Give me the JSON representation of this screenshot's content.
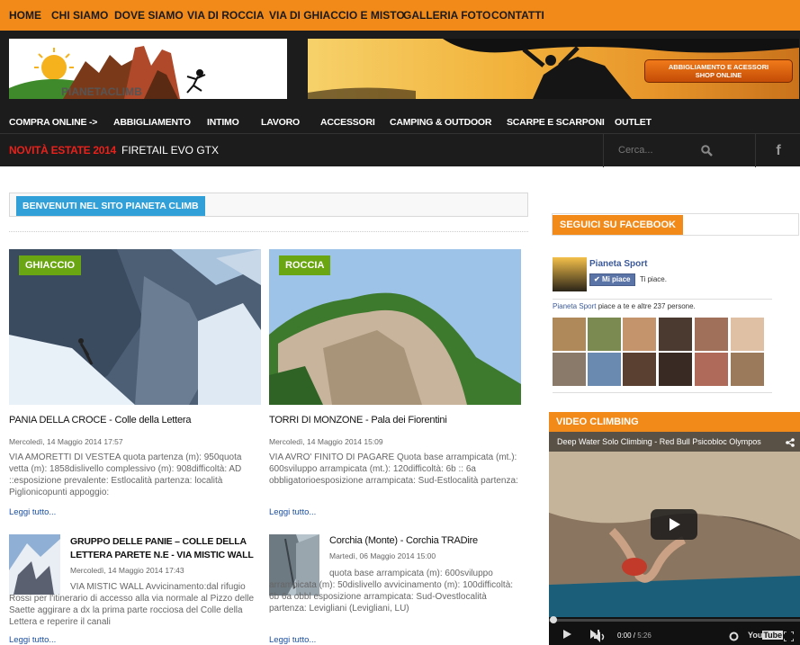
{
  "top_nav": [
    "HOME",
    "CHI SIAMO",
    "DOVE SIAMO",
    "VIA DI ROCCIA",
    "VIA DI GHIACCIO E MISTO",
    "GALLERIA FOTO",
    "CONTATTI"
  ],
  "logo_text": "PIANETACLIMB",
  "banner_button": {
    "line1": "ABBIGLIAMENTO E ACESSORI",
    "line2": "SHOP ONLINE"
  },
  "cat_nav": [
    "COMPRA ONLINE ->",
    "ABBIGLIAMENTO",
    "INTIMO",
    "LAVORO",
    "ACCESSORI",
    "CAMPING & OUTDOOR",
    "SCARPE E SCARPONI",
    "OUTLET"
  ],
  "ticker": {
    "label": "NOVITÀ ESTATE 2014",
    "text": "FIRETAIL EVO GTX"
  },
  "search": {
    "placeholder": "Cerca..."
  },
  "welcome": "BENVENUTI NEL SITO PIANETA CLIMB",
  "featured": [
    {
      "tag": "GHIACCIO",
      "title": "PANIA DELLA CROCE - Colle della Lettera",
      "date": "Mercoledì, 14 Maggio 2014 17:57",
      "body": "VIA AMORETTI DI VESTEA quota partenza (m): 950quota vetta (m): 1858dislivello complessivo (m): 908difficoltà: AD ::esposizione prevalente: Estlocalità partenza: località Piglionicopunti appoggio:",
      "more": "Leggi tutto..."
    },
    {
      "tag": "ROCCIA",
      "title": "TORRI DI MONZONE - Pala dei Fiorentini",
      "date": "Mercoledì, 14 Maggio 2014 15:09",
      "body": "VIA  AVRO' FINITO DI PAGARE   Quota base arrampicata (mt.): 600sviluppo arrampicata (mt.): 120difficoltà: 6b :: 6a obbligatorioesposizione arrampicata: Sud-Estlocalità partenza:",
      "more": "Leggi tutto..."
    }
  ],
  "small": [
    {
      "title": "GRUPPO DELLE PANIE – COLLE DELLA LETTERA PARETE N.E - VIA MISTIC WALL",
      "title1": "GRUPPO DELLE PANIE – COLLE DELLA",
      "title2": "LETTERA PARETE N.E - VIA MISTIC WALL",
      "date": "Mercoledì, 14 Maggio 2014 17:43",
      "body": "VIA MISTIC WALL Avvicinamento:dal rifugio Rossi per l'itinerario di accesso alla via normale al Pizzo delle Saette aggirare a dx la prima parte rocciosa del Colle della Lettera e reperire il canali",
      "more": "Leggi tutto..."
    },
    {
      "title": "Corchia (Monte) - Corchia TRADire",
      "date": "Martedì, 06 Maggio 2014 15:00",
      "body": "quota base arrampicata (m): 600sviluppo arrampicata (m): 50dislivello avvicinamento (m): 100difficoltà: 6b 6a obbl esposizione arrampicata: Sud-Ovestlocalità partenza: Levigliani (Levigliani, LU)",
      "more": "Leggi tutto..."
    }
  ],
  "facebook": {
    "heading": "SEGUICI SU FACEBOOK",
    "page_name": "Pianeta Sport",
    "like_btn": "Mi piace",
    "liked": "Ti piace.",
    "count_name": "Pianeta Sport",
    "count_text": " piace a te e altre 237 persone."
  },
  "video": {
    "heading": "VIDEO CLIMBING",
    "title": "Deep Water Solo Climbing - Red Bull Psicobloc Olympos",
    "time": "0:00",
    "duration": "5:26"
  },
  "colors": {
    "orange": "#f28a1a",
    "blue": "#32a0d8",
    "green": "#6aa512",
    "dark": "#1c1c1c",
    "red": "#e8211b"
  }
}
